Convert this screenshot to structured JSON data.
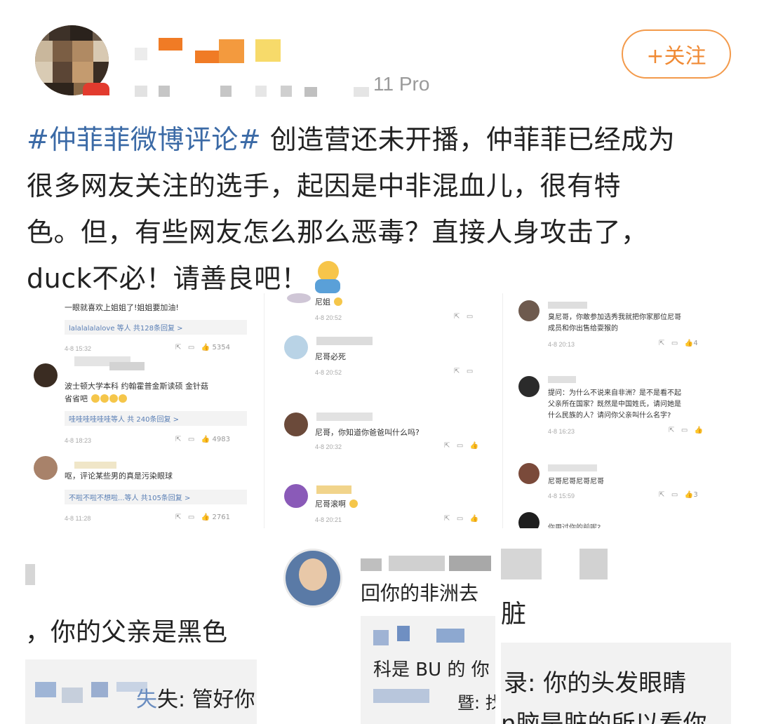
{
  "header": {
    "device": "11 Pro",
    "follow_label": "+关注"
  },
  "post": {
    "hashtag": "#仲菲菲微博评论#",
    "line1": " 创造营还未开播，仲菲菲已经成为",
    "line2": "很多网友关注的选手，起因是中非混血儿，很有特",
    "line3": "色。但，有些网友怎么那么恶毒？直接人身攻击了，",
    "line4": "duck不必！请善良吧！"
  },
  "panel1": {
    "c1": "一眼就喜欢上姐姐了!姐姐要加油!",
    "r1": "lalalalalalove 等人  共128条回复 >",
    "d1": "4-8 15:32",
    "n1": "5354",
    "c2a": "波士顿大学本科 约翰霍普金斯读硕 金针菇",
    "c2b": "省省吧",
    "r2": "哇哇哇哇哇哇等人  共 240条回复 >",
    "d2": "4-8 18:23",
    "n2": "4983",
    "c3": "呕，评论某些男的真是污染眼球",
    "r3": "不啦不啦不想啦...等人  共105条回复 >",
    "d3": "4-8 11:28",
    "n3": "2761"
  },
  "panel2": {
    "c1": "尼姐",
    "d1": "4-8 20:52",
    "c2": "尼哥必死",
    "d2": "4-8 20:52",
    "c3": "尼哥，你知道你爸爸叫什么吗?",
    "d3": "4-8 20:32",
    "c4": "尼哥滚啊",
    "d4": "4-8 20:21"
  },
  "panel3": {
    "c1a": "臭尼哥，你敢参加选秀我就把你家那位尼哥",
    "c1b": "成员和你出售给耍猴的",
    "d1": "4-8 20:13",
    "n1": "4",
    "c2a": "提问：为什么不说来自非洲？是不是看不起",
    "c2b": "父亲所在国家？既然是中国姓氏，请问她是",
    "c2c": "什么民族的人？请问你父亲叫什么名字?",
    "d2": "4-8 16:23",
    "c3": "尼哥尼哥尼哥尼哥",
    "d3": "4-8 15:59",
    "n3": "3",
    "c4": "你用过你的前呢?"
  },
  "zoom": {
    "left_line1": "，你的父亲是黑色",
    "left_line2": "失: 管好你",
    "mid_line1": "回你的非洲去",
    "mid_line2": "科是 BU 的  你",
    "mid_line3": "暨: 找",
    "right_line1": "脏",
    "right_line2": "录: 你的头发眼睛",
    "right_line3": "n脑是脏的所以看你"
  },
  "colors": {
    "hashtag": "#3b6aa6",
    "follow": "#f08a34",
    "reply_link": "#5a7fb5"
  }
}
